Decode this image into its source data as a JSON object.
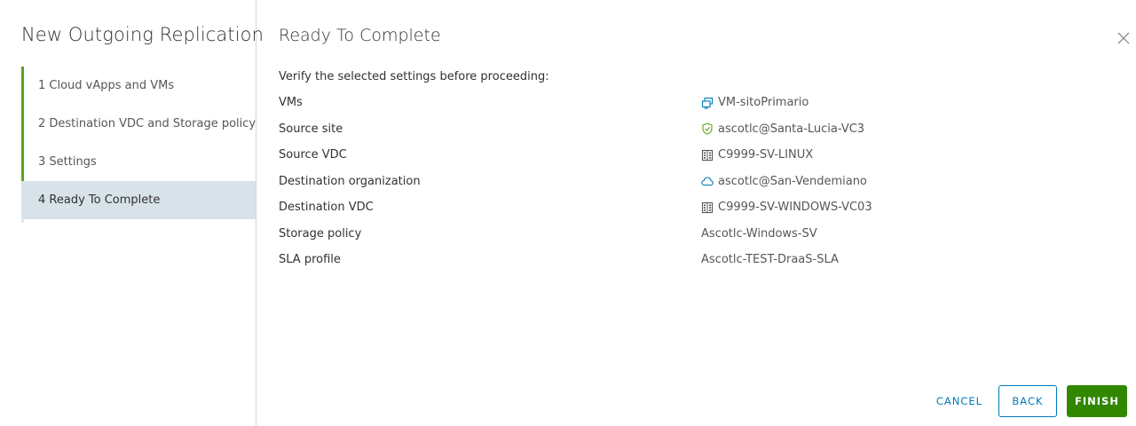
{
  "wizard": {
    "title": "New Outgoing Replication",
    "steps": [
      {
        "label": "1 Cloud vApps and VMs",
        "state": "complete"
      },
      {
        "label": "2 Destination VDC and Storage policy",
        "state": "complete"
      },
      {
        "label": "3 Settings",
        "state": "complete"
      },
      {
        "label": "4 Ready To Complete",
        "state": "active"
      }
    ]
  },
  "page": {
    "title": "Ready To Complete",
    "verify_text": "Verify the selected settings before proceeding:"
  },
  "summary": [
    {
      "label": "VMs",
      "value": "VM-sitoPrimario",
      "icon": "vm-icon"
    },
    {
      "label": "Source site",
      "value": "ascotlc@Santa-Lucia-VC3",
      "icon": "shield-check-icon"
    },
    {
      "label": "Source VDC",
      "value": "C9999-SV-LINUX",
      "icon": "building-icon"
    },
    {
      "label": "Destination organization",
      "value": "ascotlc@San-Vendemiano",
      "icon": "cloud-icon"
    },
    {
      "label": "Destination VDC",
      "value": "C9999-SV-WINDOWS-VC03",
      "icon": "building-icon"
    },
    {
      "label": "Storage policy",
      "value": "Ascotlc-Windows-SV",
      "icon": ""
    },
    {
      "label": "SLA profile",
      "value": "Ascotlc-TEST-DraaS-SLA",
      "icon": ""
    }
  ],
  "footer": {
    "cancel_label": "CANCEL",
    "back_label": "BACK",
    "finish_label": "FINISH"
  },
  "colors": {
    "accent_green": "#5aa220",
    "primary_blue": "#0079b8",
    "finish_green": "#318700",
    "active_step_bg": "#d8e3e9"
  }
}
